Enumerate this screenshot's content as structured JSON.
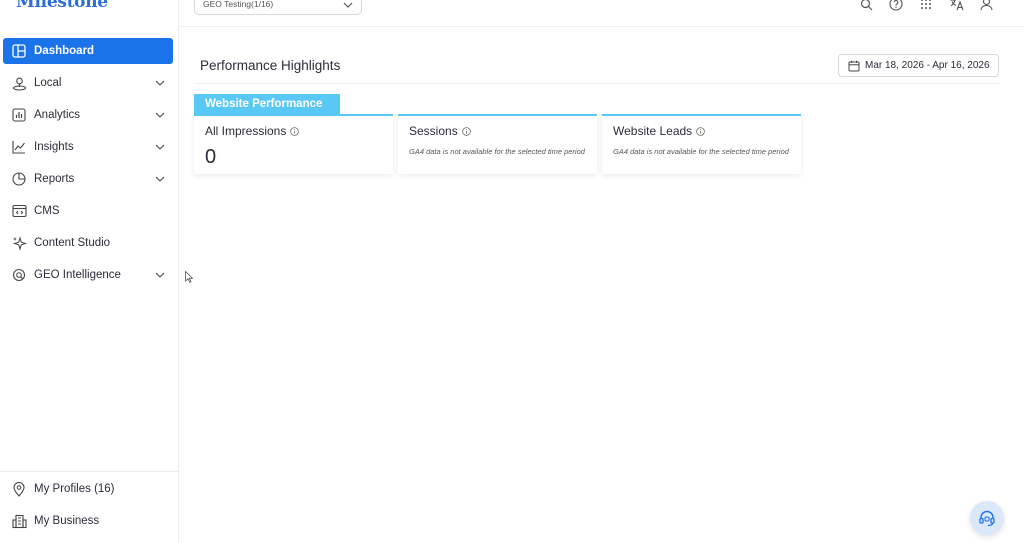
{
  "brand": {
    "logo_text": "Milestone"
  },
  "sidebar": {
    "items": [
      {
        "label": "Dashboard",
        "icon": "dashboard-icon",
        "active": true,
        "expandable": false
      },
      {
        "label": "Local",
        "icon": "location-pin-icon",
        "expandable": true
      },
      {
        "label": "Analytics",
        "icon": "bar-chart-icon",
        "expandable": true
      },
      {
        "label": "Insights",
        "icon": "trend-line-icon",
        "expandable": true
      },
      {
        "label": "Reports",
        "icon": "pie-chart-icon",
        "expandable": true
      },
      {
        "label": "CMS",
        "icon": "code-window-icon",
        "expandable": false
      },
      {
        "label": "Content Studio",
        "icon": "sparkle-icon",
        "expandable": false
      },
      {
        "label": "GEO Intelligence",
        "icon": "geo-search-icon",
        "expandable": true
      }
    ],
    "bottom_items": [
      {
        "label": "My Profiles (16)",
        "icon": "map-pin-icon"
      },
      {
        "label": "My Business",
        "icon": "building-icon"
      }
    ]
  },
  "topbar": {
    "profile_selector": {
      "value": "GEO Testing(1/16)"
    },
    "icons": [
      "search-icon",
      "help-icon",
      "apps-grid-icon",
      "translate-icon",
      "user-icon"
    ]
  },
  "main": {
    "section_title": "Performance Highlights",
    "date_range": "Mar 18, 2026 - Apr 16, 2026",
    "tab_label": "Website Performance",
    "cards": [
      {
        "title": "All Impressions",
        "value": "0",
        "note": ""
      },
      {
        "title": "Sessions",
        "value": "",
        "note": "GA4 data is not available for the selected time period"
      },
      {
        "title": "Website Leads",
        "value": "",
        "note": "GA4 data is not available for the selected time period"
      }
    ]
  },
  "colors": {
    "accent": "#1a73e8",
    "tab": "#5ac8f5",
    "brand": "#2a6fd1"
  }
}
